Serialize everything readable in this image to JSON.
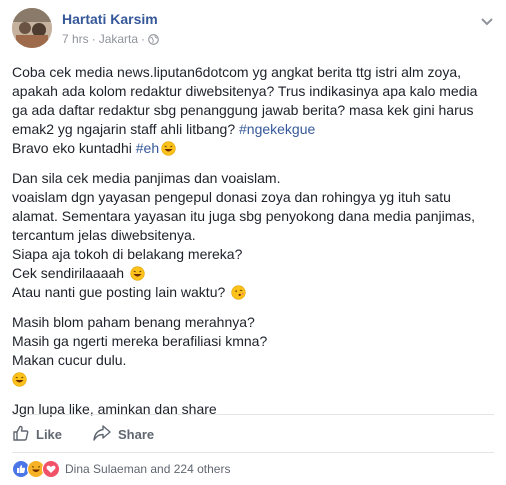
{
  "post": {
    "author": "Hartati Karsim",
    "time": "7 hrs",
    "separator": "·",
    "location": "Jakarta",
    "separator2": "·",
    "privacy_icon": "globe-icon",
    "menu_icon": "chevron-down-icon",
    "body": {
      "p1": {
        "l1": "Coba cek media news.liputan6dotcom yg angkat berita ttg istri alm zoya,",
        "l2": "apakah ada kolom redaktur diwebsitenya? Trus indikasinya apa kalo media",
        "l3": "ga ada daftar redaktur sbg penanggung jawab berita? masa kek gini harus",
        "l4_text": "emak2 yg ngajarin staff ahli litbang? ",
        "l4_hashtag": "#ngekekgue",
        "l5_text": "Bravo eko kuntadhi ",
        "l5_hashtag": "#eh",
        "l5_emoji": "laughing-emoji"
      },
      "p2": {
        "l1": "Dan sila cek media panjimas dan voaislam.",
        "l2": "voaislam dgn yayasan pengepul donasi zoya dan rohingya yg ituh satu",
        "l3": "alamat. Sementara yayasan itu juga sbg penyokong dana media panjimas,",
        "l4": "tercantum jelas diwebsitenya.",
        "l5": "Siapa aja tokoh di belakang mereka?",
        "l6": "Cek sendirilaaaah",
        "l6_emoji": "laughing-emoji",
        "l7": "Atau nanti gue posting lain waktu?",
        "l7_emoji": "kissing-emoji"
      },
      "p3": {
        "l1": "Masih blom paham benang merahnya?",
        "l2": "Masih ga ngerti mereka berafiliasi kmna?",
        "l3": "Makan cucur dulu.",
        "l4_emoji": "laughing-emoji"
      },
      "p4": {
        "l1": "Jgn lupa like, aminkan dan share"
      }
    },
    "actions": {
      "like_label": "Like",
      "share_label": "Share"
    },
    "reactions": {
      "icons": [
        "like-reaction-icon",
        "haha-reaction-icon",
        "love-reaction-icon"
      ],
      "summary": "Dina Sulaeman and 224 others"
    }
  },
  "colors": {
    "link_blue": "#365899",
    "meta_gray": "#90949c",
    "action_gray": "#606770",
    "text": "#1d2129"
  }
}
